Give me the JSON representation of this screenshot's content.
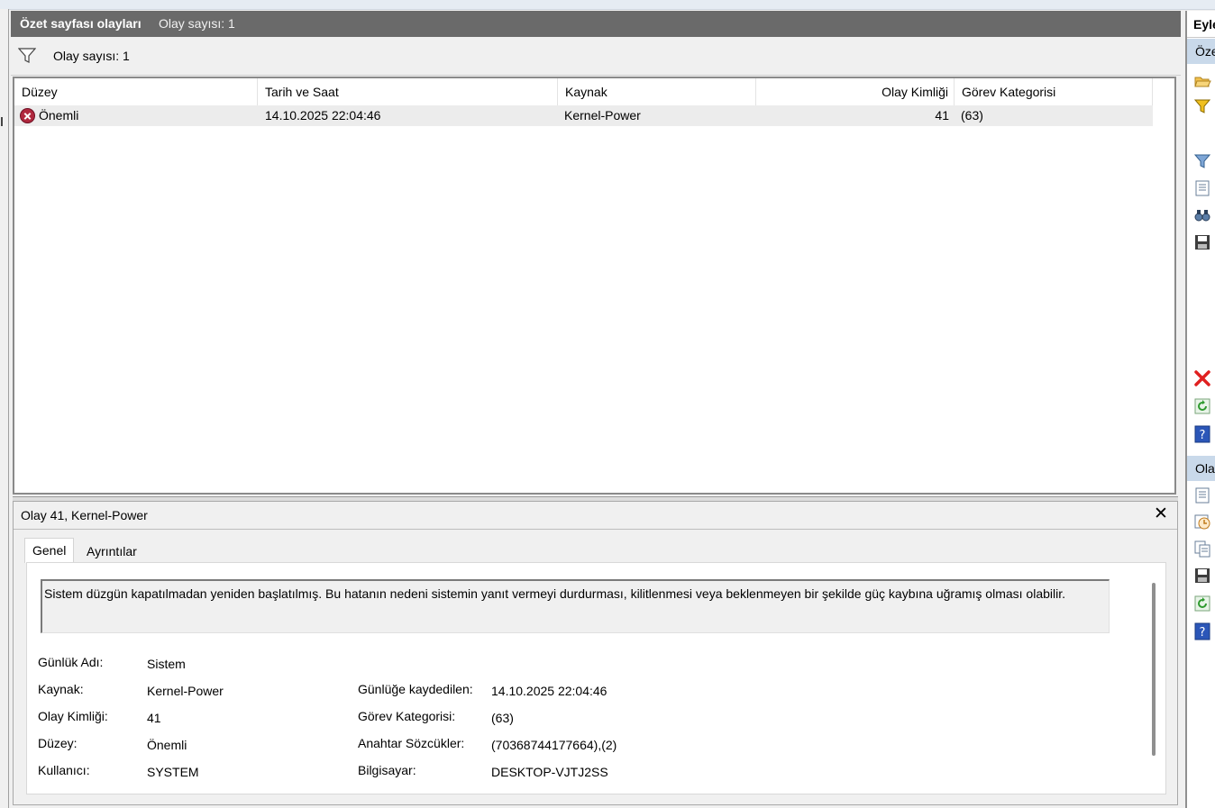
{
  "header": {
    "title": "Özet sayfası olayları",
    "event_count": "Olay sayısı: 1"
  },
  "filter": {
    "icon": "filter-icon",
    "count_text": "Olay sayısı: 1"
  },
  "list": {
    "columns": [
      "Düzey",
      "Tarih ve Saat",
      "Kaynak",
      "Olay Kimliği",
      "Görev Kategorisi"
    ],
    "rows": [
      {
        "level_icon": "error-icon",
        "level": "Önemli",
        "datetime": "14.10.2025 22:04:46",
        "source": "Kernel-Power",
        "event_id": "41",
        "task_category": "(63)"
      }
    ]
  },
  "details": {
    "title": "Olay 41, Kernel-Power",
    "close_icon": "close-icon",
    "tabs": [
      "Genel",
      "Ayrıntılar"
    ],
    "description": "Sistem düzgün kapatılmadan yeniden başlatılmış. Bu hatanın nedeni sistemin yanıt vermeyi durdurması, kilitlenmesi veya beklenmeyen bir şekilde güç kaybına uğramış olması olabilir.",
    "fields_left": [
      {
        "label": "Günlük Adı:",
        "value": "Sistem"
      },
      {
        "label": "Kaynak:",
        "value": "Kernel-Power"
      },
      {
        "label": "Olay Kimliği:",
        "value": "41"
      },
      {
        "label": "Düzey:",
        "value": "Önemli"
      },
      {
        "label": "Kullanıcı:",
        "value": "SYSTEM"
      }
    ],
    "fields_right": [
      {
        "label": "Günlüğe kaydedilen:",
        "value": "14.10.2025 22:04:46"
      },
      {
        "label": "Görev Kategorisi:",
        "value": "(63)"
      },
      {
        "label": "Anahtar Sözcükler:",
        "value": "(70368744177664),(2)"
      },
      {
        "label": "Bilgisayar:",
        "value": "DESKTOP-VJTJ2SS"
      }
    ]
  },
  "actions": {
    "header": "Eyle",
    "section1": "Öze",
    "section2": "Ola",
    "icons": [
      "open-folder-icon",
      "filter-icon",
      "filter-icon",
      "properties-icon",
      "find-icon",
      "save-icon",
      "delete-icon",
      "refresh-icon",
      "help-icon",
      "properties-icon",
      "attach-task-icon",
      "copy-icon",
      "save-icon",
      "refresh-icon",
      "help-icon"
    ]
  },
  "colors": {
    "title_bar": "#6a6a6a",
    "selected_row": "#ececec",
    "actions_section": "#c9d9ea",
    "error": "#b0283e"
  }
}
